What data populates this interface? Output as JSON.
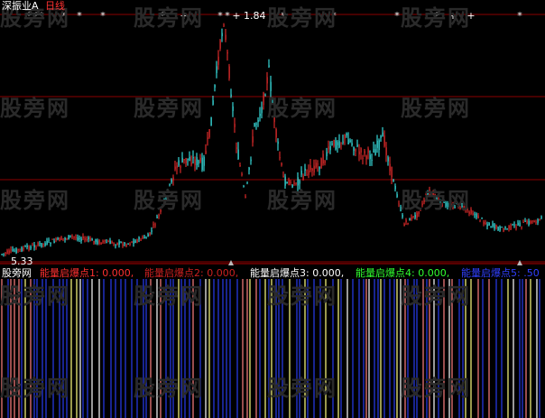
{
  "header": {
    "symbol": "深振业A",
    "period": "日线",
    "high_label": "1.84",
    "low_label": "5.33"
  },
  "indicator": {
    "name": "股旁网",
    "items": [
      {
        "label": "能量启爆点1: 0.000,",
        "color": "#ff3030"
      },
      {
        "label": "能量启爆点2: 0.000,",
        "color": "#cc2020"
      },
      {
        "label": "能量启爆点3: 0.000,",
        "color": "#ffffff"
      },
      {
        "label": "能量启爆点4: 0.000,",
        "color": "#30ff30"
      },
      {
        "label": "能量启爆点5: .50",
        "color": "#3040ff"
      }
    ]
  },
  "watermark": "股旁网",
  "colors": {
    "up": "#ff3030",
    "down": "#40ffff",
    "grid": "#8b0000",
    "marker": "#ffffff",
    "bar_blue": "#2030c0",
    "bar_yellow": "#ffff80",
    "bar_white": "#ffffff",
    "bar_pink": "#ff8080"
  },
  "markers": {
    "star_count": 14,
    "plus_count": 4,
    "triangle_count": 2
  }
}
